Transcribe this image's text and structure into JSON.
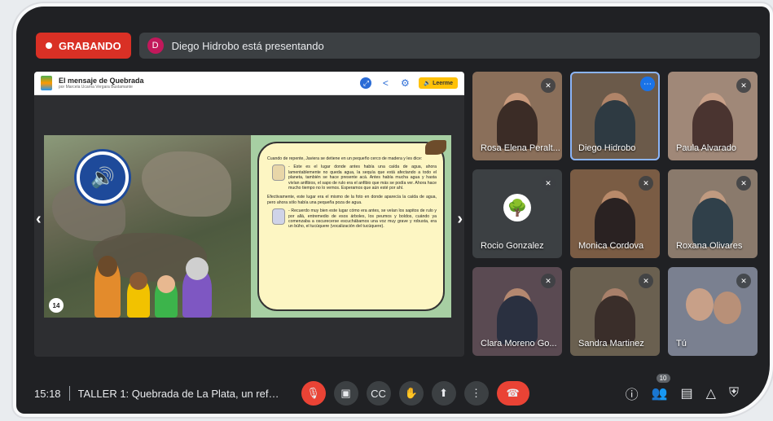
{
  "recording": {
    "label": "GRABANDO"
  },
  "presenter": {
    "initial": "D",
    "text": "Diego Hidrobo está presentando"
  },
  "slide": {
    "title": "El mensaje de Quebrada",
    "subtitle": "por Marcela Ucarria Vergara Bustamante",
    "read_button": "🔊 Leerme",
    "page_number": "14",
    "paragraph1": "Cuando de repente, Javiera se detiene en un pequeño cerco de madera y les dice:",
    "quote1": "- Este es el lugar donde antes había una caída de agua, ahora lamentablemente no queda agua, la sequía que está afectando a todo el planeta, también se hace presente acá. Antes había mucha agua y hasta vivían anfibios, el sapo de rulo era el anfibio que más se podía ver. Ahora hace mucho tiempo no lo vemos. Esperamos que aún esté por ahí.",
    "paragraph2": "Efectivamente, este lugar era el mismo de la foto en donde aparecía la caída de agua, pero ahora sólo había una pequeña poza de agua.",
    "quote2": "- Recuerdo muy bien este lugar cómo era antes, se veían los sapitos de rulo y por allá, entremedio de esos árboles, los peumos y boldos, cuándo ya comenzaba a oscurecerse escuchábamos una voz muy grave y robusta, era un búho, el tucúquere (vocalización del tucúquere)."
  },
  "participants": [
    {
      "name": "Rosa Elena Peralt...",
      "muted": true,
      "bg": "#8a6f5a"
    },
    {
      "name": "Diego Hidrobo",
      "muted": false,
      "active": true,
      "bg": "#6b5a4a"
    },
    {
      "name": "Paula Alvarado",
      "muted": true,
      "bg": "#a08878"
    },
    {
      "name": "Rocio Gonzalez",
      "muted": true,
      "bg": "#3c4043"
    },
    {
      "name": "Monica Cordova",
      "muted": true,
      "bg": "#7a5c44"
    },
    {
      "name": "Roxana Olivares",
      "muted": true,
      "bg": "#8a7a6c"
    },
    {
      "name": "Clara Moreno Go...",
      "muted": true,
      "bg": "#5a4a52"
    },
    {
      "name": "Sandra Martinez",
      "muted": true,
      "bg": "#6a6050"
    },
    {
      "name": "Tú",
      "muted": true,
      "bg": "#7a8090"
    }
  ],
  "bottom": {
    "time": "15:18",
    "meeting_title": "TALLER 1: Quebrada de La Plata, un refugio ...",
    "participant_count": "10"
  },
  "icons": {
    "mic_off": "mic-off-icon",
    "camera": "camera-icon",
    "captions": "captions-icon",
    "hand": "raise-hand-icon",
    "present": "present-icon",
    "more": "more-vert-icon",
    "end_call": "end-call-icon",
    "info": "info-icon",
    "people": "people-icon",
    "chat": "chat-icon",
    "activities": "activities-icon",
    "lock": "host-controls-icon"
  }
}
